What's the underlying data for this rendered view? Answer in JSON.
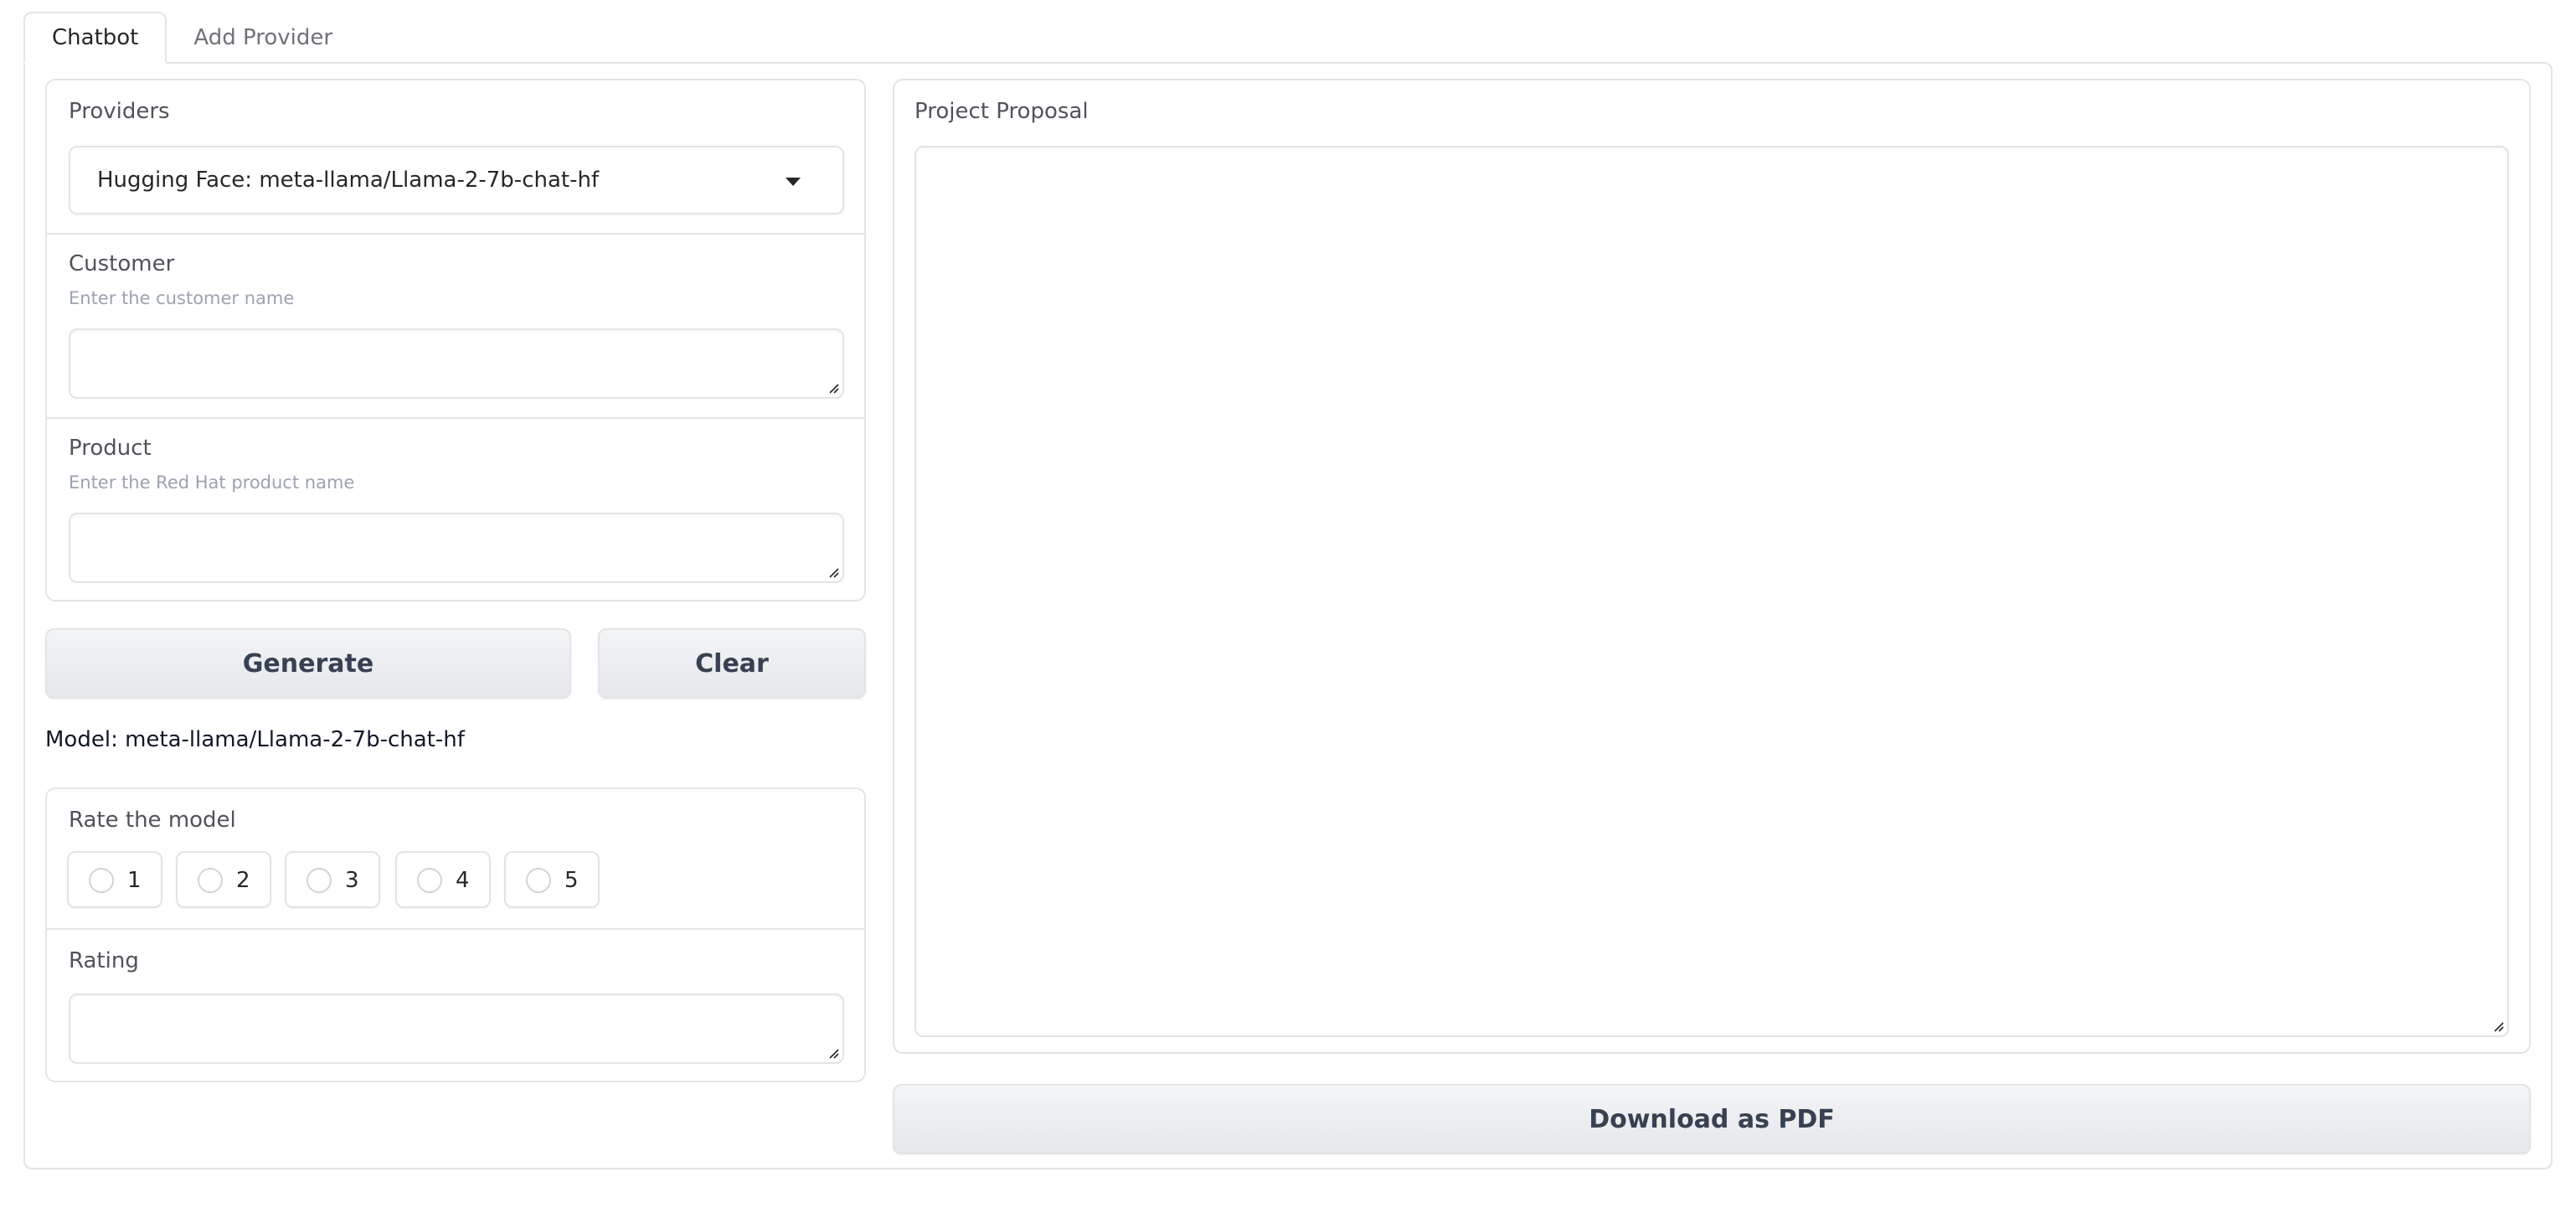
{
  "tabs": [
    {
      "label": "Chatbot",
      "active": true
    },
    {
      "label": "Add Provider",
      "active": false
    }
  ],
  "providers": {
    "label": "Providers",
    "selected": "Hugging Face: meta-llama/Llama-2-7b-chat-hf"
  },
  "customer": {
    "label": "Customer",
    "info": "Enter the customer name",
    "value": ""
  },
  "product": {
    "label": "Product",
    "info": "Enter the Red Hat product name",
    "value": ""
  },
  "buttons": {
    "generate": "Generate",
    "clear": "Clear",
    "download": "Download as PDF"
  },
  "model_text": "Model: meta-llama/Llama-2-7b-chat-hf",
  "rate": {
    "label": "Rate the model",
    "options": [
      "1",
      "2",
      "3",
      "4",
      "5"
    ]
  },
  "rating": {
    "label": "Rating",
    "value": ""
  },
  "proposal": {
    "label": "Project Proposal",
    "value": ""
  },
  "colors": {
    "border": "#e4e4e7",
    "label": "#52525b",
    "info": "#9ca3af",
    "button_bg": "#f3f4f6"
  }
}
